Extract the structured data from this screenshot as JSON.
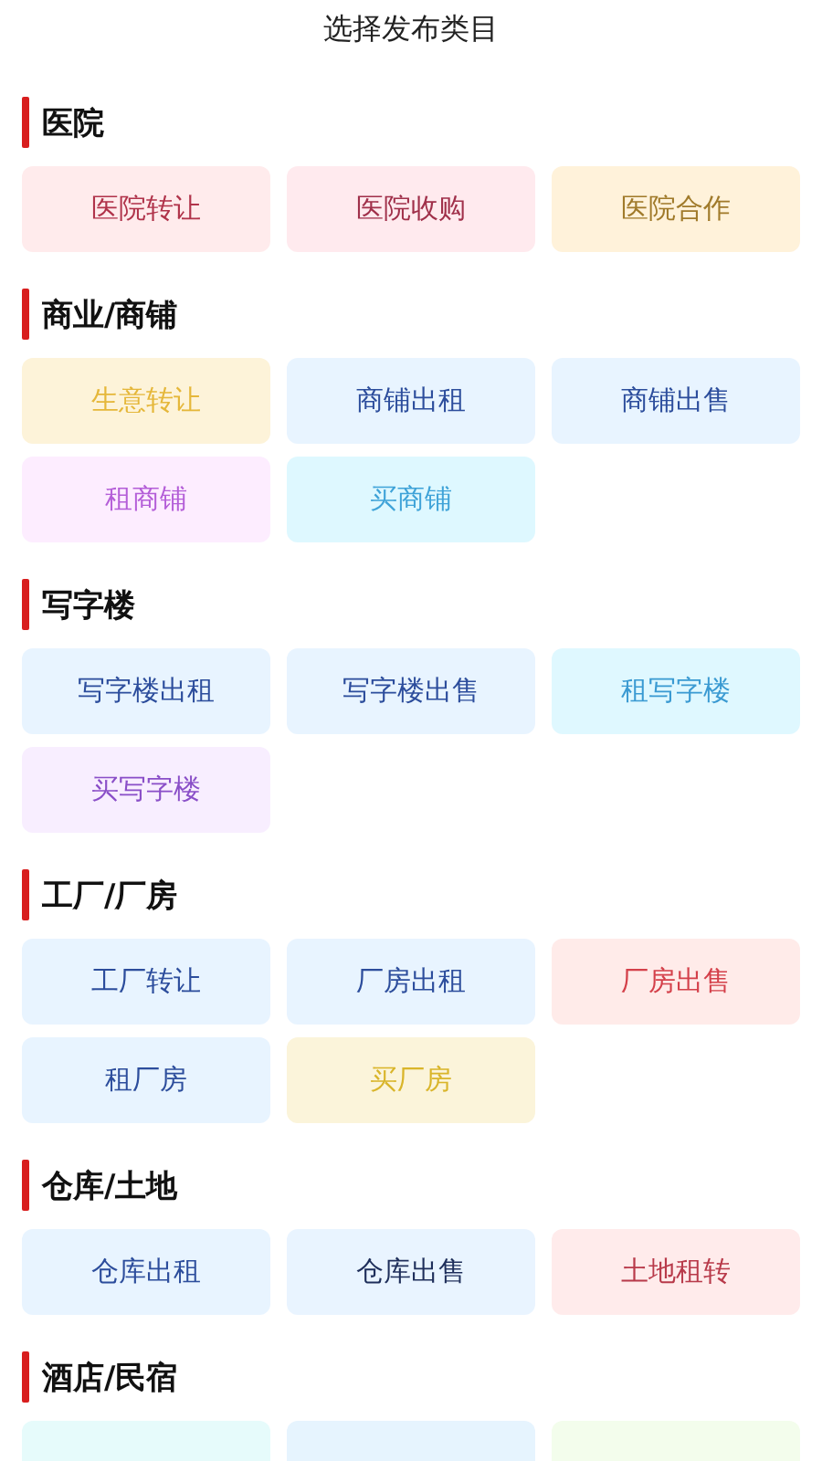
{
  "title": "选择发布类目",
  "sections": [
    {
      "heading": "医院",
      "items": [
        {
          "label": "医院转让",
          "color": "#b0334a"
        },
        {
          "label": "医院收购",
          "color": "#a0304a"
        },
        {
          "label": "医院合作",
          "color": "#a07a2a"
        }
      ]
    },
    {
      "heading": "商业/商铺",
      "items": [
        {
          "label": "生意转让",
          "color": "#e5b73a"
        },
        {
          "label": "商铺出租",
          "color": "#2c4d9c"
        },
        {
          "label": "商铺出售",
          "color": "#2c4d9c"
        },
        {
          "label": "租商铺",
          "color": "#b45ed8"
        },
        {
          "label": "买商铺",
          "color": "#3fa3d8"
        }
      ]
    },
    {
      "heading": "写字楼",
      "items": [
        {
          "label": "写字楼出租",
          "color": "#2c4d9c"
        },
        {
          "label": "写字楼出售",
          "color": "#2c4d9c"
        },
        {
          "label": "租写字楼",
          "color": "#3a9ad2"
        },
        {
          "label": "买写字楼",
          "color": "#8a4fc8"
        }
      ]
    },
    {
      "heading": "工厂/厂房",
      "items": [
        {
          "label": "工厂转让",
          "color": "#2c4d9c"
        },
        {
          "label": "厂房出租",
          "color": "#2c4d9c"
        },
        {
          "label": "厂房出售",
          "color": "#d4404a"
        },
        {
          "label": "租厂房",
          "color": "#2c4d9c"
        },
        {
          "label": "买厂房",
          "color": "#d9b52a"
        }
      ]
    },
    {
      "heading": "仓库/土地",
      "items": [
        {
          "label": "仓库出租",
          "color": "#2c4d9c"
        },
        {
          "label": "仓库出售",
          "color": "#1e2e5a"
        },
        {
          "label": "土地租转",
          "color": "#b83a4a"
        }
      ]
    },
    {
      "heading": "酒店/民宿",
      "items": [
        {
          "color": "#e6fbfb"
        },
        {
          "color": "#e6f4fe"
        },
        {
          "color": "#f3fdec"
        }
      ]
    }
  ]
}
